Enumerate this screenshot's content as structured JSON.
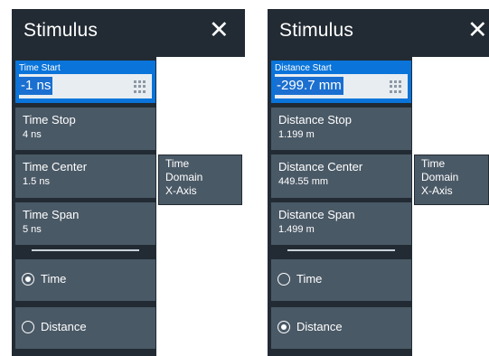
{
  "left_panel": {
    "title": "Stimulus",
    "close_glyph": "✕",
    "active_field": {
      "label": "Time Start",
      "value": "-1 ns"
    },
    "buttons": [
      {
        "label": "Time Stop",
        "value": "4 ns"
      },
      {
        "label": "Time Center",
        "value": "1.5 ns"
      },
      {
        "label": "Time Span",
        "value": "5 ns"
      }
    ],
    "radios": [
      {
        "label": "Time",
        "checked": true
      },
      {
        "label": "Distance",
        "checked": false
      }
    ],
    "tooltip": {
      "line1": "Time",
      "line2": "Domain",
      "line3": "X-Axis"
    }
  },
  "right_panel": {
    "title": "Stimulus",
    "close_glyph": "✕",
    "active_field": {
      "label": "Distance Start",
      "value": "-299.7 mm"
    },
    "buttons": [
      {
        "label": "Distance Stop",
        "value": "1.199 m"
      },
      {
        "label": "Distance Center",
        "value": "449.55 mm"
      },
      {
        "label": "Distance Span",
        "value": "1.499 m"
      }
    ],
    "radios": [
      {
        "label": "Time",
        "checked": false
      },
      {
        "label": "Distance",
        "checked": true
      }
    ],
    "tooltip": {
      "line1": "Time",
      "line2": "Domain",
      "line3": "X-Axis"
    }
  },
  "colors": {
    "header_bg": "#222b33",
    "button_bg": "#4a5966",
    "active_bg": "#0a74da",
    "field_bg": "#e8edf2",
    "text": "#ffffff"
  },
  "icons": [
    "close-icon",
    "keypad-icon",
    "radio-icon"
  ]
}
